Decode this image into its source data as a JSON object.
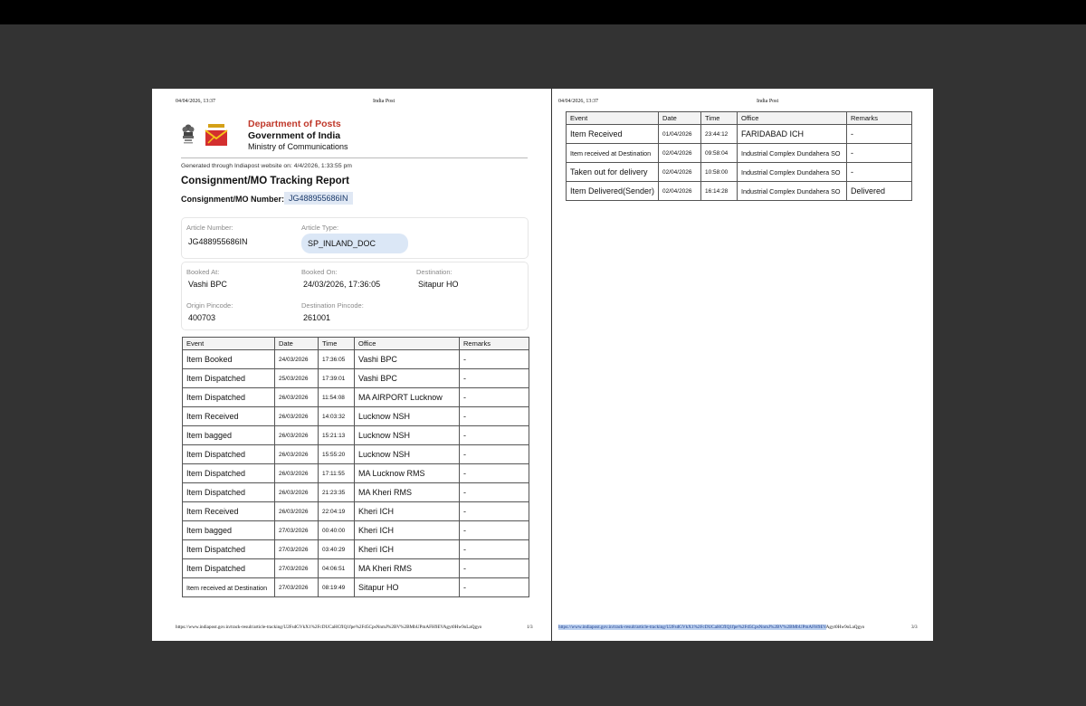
{
  "page1": {
    "header_datetime": "04/04/2026, 13:37",
    "header_title": "India Post",
    "org": {
      "dept": "Department of Posts",
      "govt": "Government of India",
      "ministry": "Ministry of Communications"
    },
    "generated": "Generated through Indiapost website on: 4/4/2026, 1:33:55 pm",
    "report_title": "Consignment/MO Tracking Report",
    "consignment_label": "Consignment/MO Number:",
    "consignment_number": "JG488955686IN",
    "article": {
      "number_label": "Article Number:",
      "number": "JG488955686IN",
      "type_label": "Article Type:",
      "type": "SP_INLAND_DOC"
    },
    "booking": {
      "booked_at_label": "Booked At:",
      "booked_at": "Vashi BPC",
      "booked_on_label": "Booked On:",
      "booked_on": "24/03/2026, 17:36:05",
      "destination_label": "Destination:",
      "destination": "Sitapur HO",
      "origin_pin_label": "Origin Pincode:",
      "origin_pin": "400703",
      "dest_pin_label": "Destination Pincode:",
      "dest_pin": "261001"
    },
    "table_headers": [
      "Event",
      "Date",
      "Time",
      "Office",
      "Remarks"
    ],
    "rows": [
      {
        "event": "Item Booked",
        "date": "24/03/2026",
        "time": "17:36:05",
        "office": "Vashi BPC",
        "remarks": "-"
      },
      {
        "event": "Item Dispatched",
        "date": "25/03/2026",
        "time": "17:39:01",
        "office": "Vashi BPC",
        "remarks": "-"
      },
      {
        "event": "Item Dispatched",
        "date": "26/03/2026",
        "time": "11:54:08",
        "office": "MA AIRPORT Lucknow",
        "remarks": "-"
      },
      {
        "event": "Item Received",
        "date": "26/03/2026",
        "time": "14:03:32",
        "office": "Lucknow NSH",
        "remarks": "-"
      },
      {
        "event": "Item bagged",
        "date": "26/03/2026",
        "time": "15:21:13",
        "office": "Lucknow NSH",
        "remarks": "-"
      },
      {
        "event": "Item Dispatched",
        "date": "26/03/2026",
        "time": "15:55:20",
        "office": "Lucknow NSH",
        "remarks": "-"
      },
      {
        "event": "Item Dispatched",
        "date": "26/03/2026",
        "time": "17:11:55",
        "office": "MA Lucknow RMS",
        "remarks": "-"
      },
      {
        "event": "Item Dispatched",
        "date": "26/03/2026",
        "time": "21:23:35",
        "office": "MA Kheri RMS",
        "remarks": "-"
      },
      {
        "event": "Item Received",
        "date": "26/03/2026",
        "time": "22:04:19",
        "office": "Kheri ICH",
        "remarks": "-"
      },
      {
        "event": "Item bagged",
        "date": "27/03/2026",
        "time": "00:40:00",
        "office": "Kheri ICH",
        "remarks": "-"
      },
      {
        "event": "Item Dispatched",
        "date": "27/03/2026",
        "time": "03:40:29",
        "office": "Kheri ICH",
        "remarks": "-"
      },
      {
        "event": "Item Dispatched",
        "date": "27/03/2026",
        "time": "04:06:51",
        "office": "MA Kheri RMS",
        "remarks": "-"
      },
      {
        "event": "Item received at Destination",
        "date": "27/03/2026",
        "time": "08:19:49",
        "office": "Sitapur HO",
        "remarks": "-"
      }
    ],
    "footer_url": "https://www.indiapost.gov.in/track-result/article-tracking/U2FsdGVkX1%2FcDUCaHCfIQ1fpe%2Fd5CpsNnmJ%2BV%2BMbUPmAFH9EVAgyt0Hw9oLaQgyo",
    "footer_page": "1/3"
  },
  "page2": {
    "header_datetime": "04/04/2026, 13:37",
    "header_title": "India Post",
    "table_headers": [
      "Event",
      "Date",
      "Time",
      "Office",
      "Remarks"
    ],
    "rows": [
      {
        "event": "Item Received",
        "date": "01/04/2026",
        "time": "23:44:12",
        "office": "FARIDABAD  ICH",
        "remarks": "-"
      },
      {
        "event": "Item received at Destination",
        "date": "02/04/2026",
        "time": "09:58:04",
        "office": "Industrial Complex Dundahera SO",
        "remarks": "-"
      },
      {
        "event": "Taken out for delivery",
        "date": "02/04/2026",
        "time": "10:58:00",
        "office": "Industrial Complex Dundahera SO",
        "remarks": "-"
      },
      {
        "event": "Item Delivered(Sender)",
        "date": "02/04/2026",
        "time": "16:14:28",
        "office": "Industrial Complex Dundahera SO",
        "remarks": "Delivered"
      }
    ],
    "footer_url_highlighted": "https://www.indiapost.gov.in/track-result/article-tracking/U2FsdGVkX1%2FcDUCaHCfIQ1fpe%2Fd5CpsNnmJ%2BV%2BMbUPmAFH9EV",
    "footer_url_rest": "Agyt0Hw9oLaQgyo",
    "footer_page": "3/3"
  },
  "colors": {
    "dept_red": "#c0392b",
    "pill_blue": "#dbe7f6",
    "viewer_bg": "#333333"
  }
}
